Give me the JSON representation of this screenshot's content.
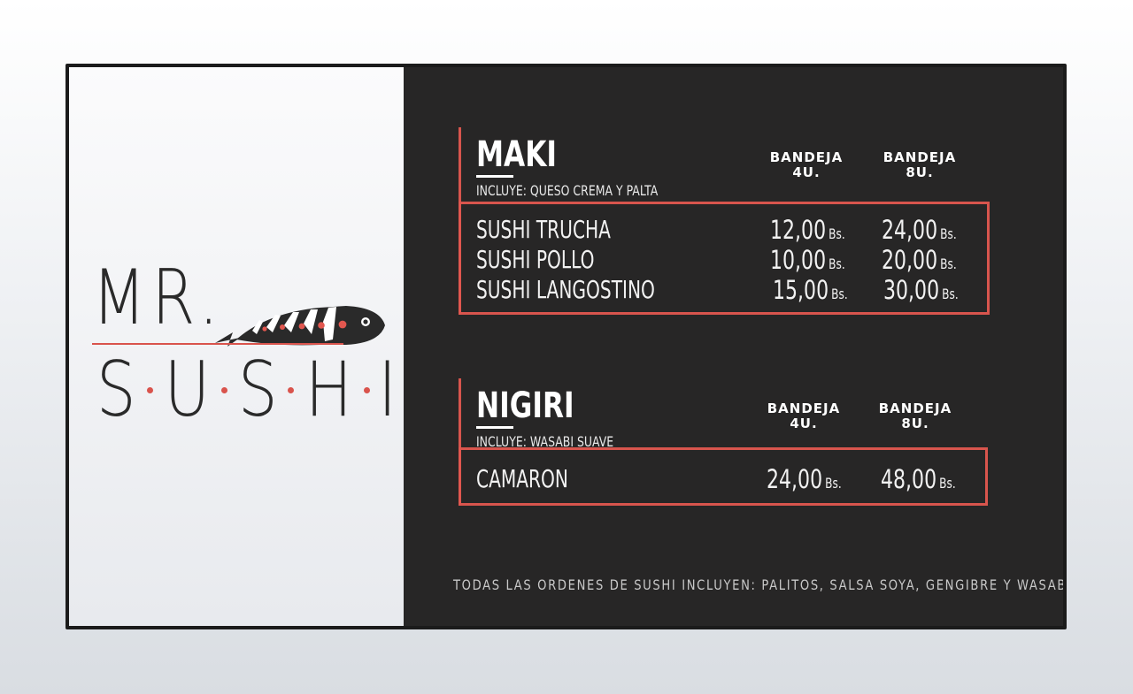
{
  "brand": {
    "line1": "MR.",
    "line2_letters": [
      "S",
      "U",
      "S",
      "H",
      "I"
    ],
    "accent_color": "#e2574f",
    "mascot_icon": "sushi-fish-logo"
  },
  "menu": {
    "maki": {
      "title": "MAKI",
      "includes": "INCLUYE: QUESO CREMA Y PALTA",
      "col1": [
        "BANDEJA",
        "4U."
      ],
      "col2": [
        "BANDEJA",
        "8U."
      ],
      "items": [
        {
          "name": "SUSHI TRUCHA",
          "price4": "12,00",
          "price8": "24,00",
          "unit": "Bs."
        },
        {
          "name": "SUSHI POLLO",
          "price4": "10,00",
          "price8": "20,00",
          "unit": "Bs."
        },
        {
          "name": "SUSHI LANGOSTINO",
          "price4": "15,00",
          "price8": "30,00",
          "unit": "Bs."
        }
      ]
    },
    "nigiri": {
      "title": "NIGIRI",
      "includes": "INCLUYE: WASABI SUAVE",
      "col1": [
        "BANDEJA",
        "4U."
      ],
      "col2": [
        "BANDEJA",
        "8U."
      ],
      "items": [
        {
          "name": "CAMARON",
          "price4": "24,00",
          "price8": "48,00",
          "unit": "Bs."
        }
      ]
    }
  },
  "footer": {
    "note": "TODAS LAS ORDENES DE SUSHI INCLUYEN: PALITOS, SALSA SOYA, GENGIBRE Y WASABI"
  }
}
